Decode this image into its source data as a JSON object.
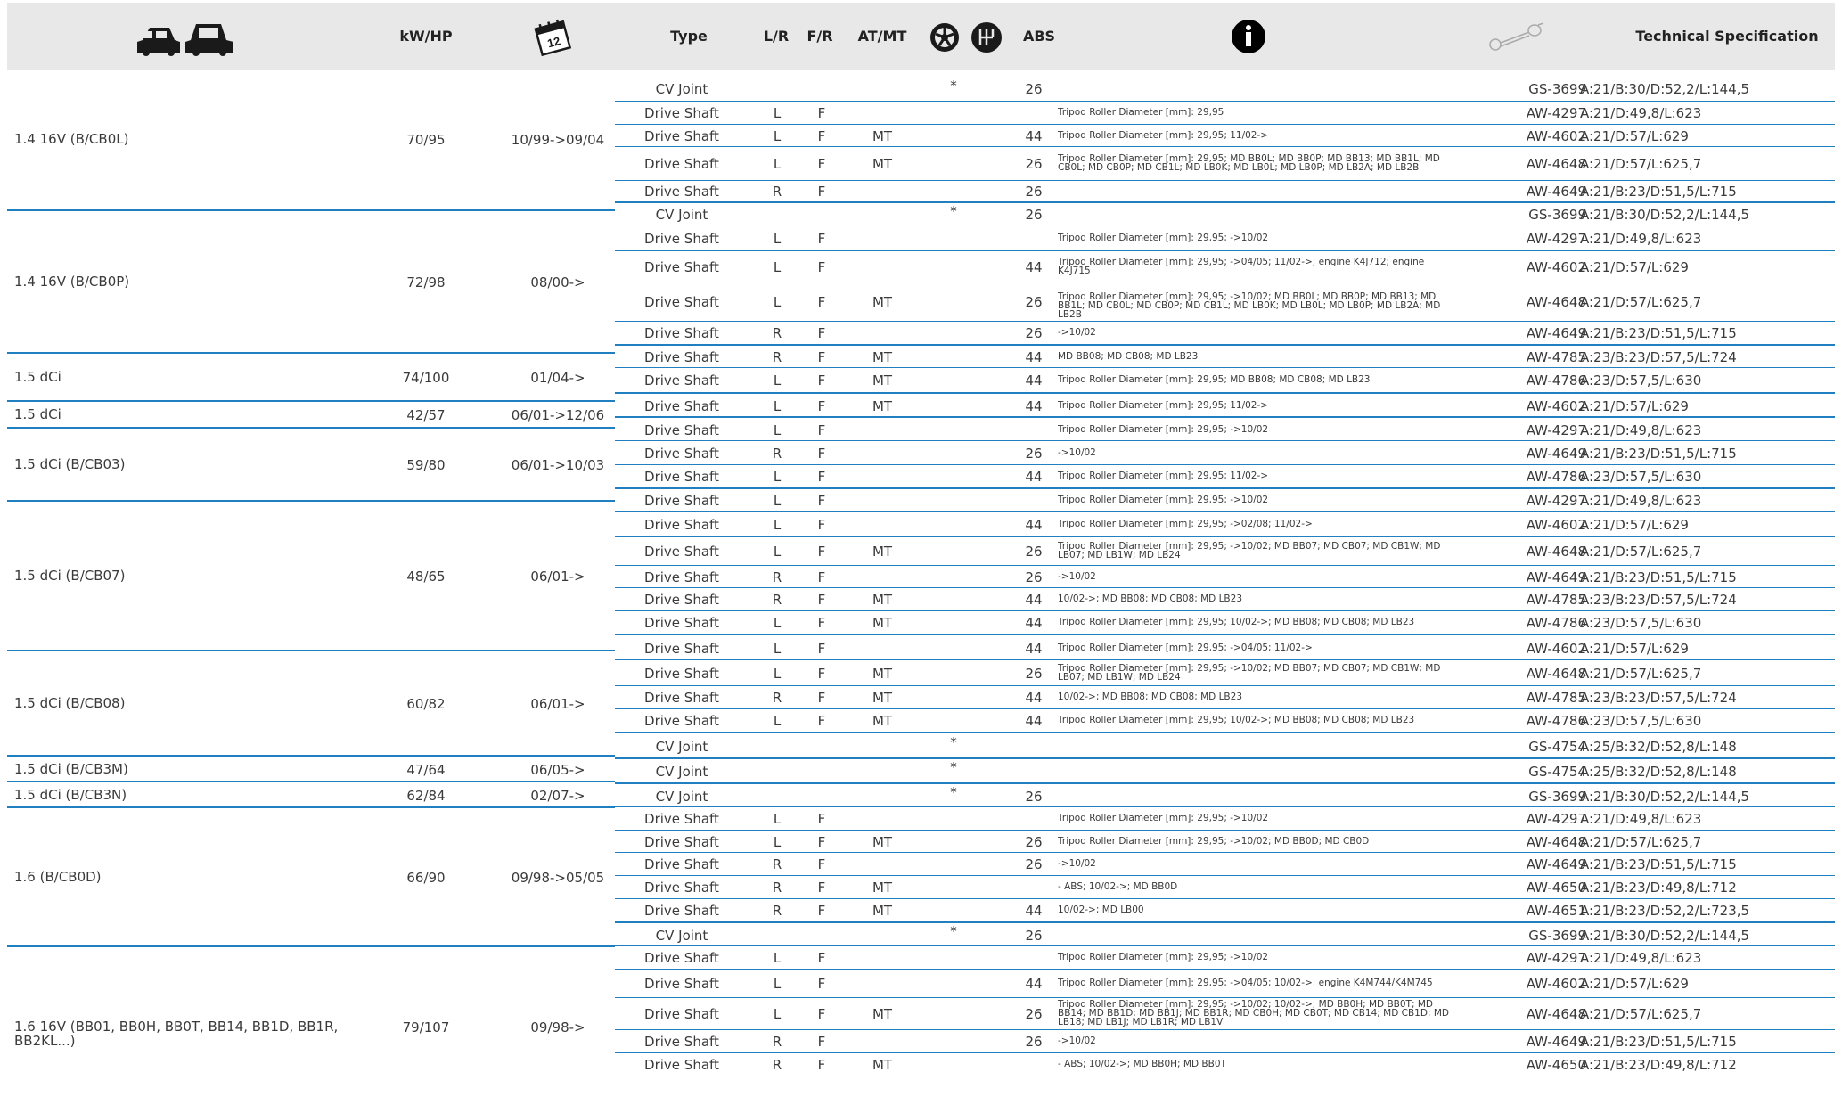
{
  "header": {
    "kw": "kW/HP",
    "type": "Type",
    "lr": "L/R",
    "fr": "F/R",
    "atmt": "AT/MT",
    "abs": "ABS",
    "calendar_num": "12",
    "spec": "Technical Specification",
    "icons": [
      "two-cars-icon",
      "calendar-icon",
      "wheel-icon",
      "gearbox-icon",
      "info-icon",
      "axle-shaft-icon"
    ]
  },
  "groups": [
    {
      "name": "1.4 16V (B/CB0L)",
      "kw": "70/95",
      "years": "10/99->09/04"
    },
    {
      "name": "1.4 16V (B/CB0P)",
      "kw": "72/98",
      "years": "08/00->"
    },
    {
      "name": "1.5 dCi",
      "kw": "74/100",
      "years": "01/04->"
    },
    {
      "name": "1.5 dCi",
      "kw": "42/57",
      "years": "06/01->12/06"
    },
    {
      "name": "1.5 dCi (B/CB03)",
      "kw": "59/80",
      "years": "06/01->10/03"
    },
    {
      "name": "1.5 dCi (B/CB07)",
      "kw": "48/65",
      "years": "06/01->"
    },
    {
      "name": "1.5 dCi (B/CB08)",
      "kw": "60/82",
      "years": "06/01->"
    },
    {
      "name": "1.5 dCi (B/CB3M)",
      "kw": "47/64",
      "years": "06/05->"
    },
    {
      "name": "1.5 dCi (B/CB3N)",
      "kw": "62/84",
      "years": "02/07->"
    },
    {
      "name": "1.6 (B/CB0D)",
      "kw": "66/90",
      "years": "09/98->05/05"
    },
    {
      "name": "1.6 16V (BB01, BB0H, BB0T, BB14, BB1D, BB1R, BB2KL...)",
      "kw": "79/107",
      "years": "09/98->"
    }
  ],
  "rows": [
    {
      "type": "CV Joint",
      "lr": "",
      "fr": "",
      "atmt": "",
      "star": "*",
      "abs": "26",
      "info": "",
      "code": "GS-3699",
      "spec": "A:21/B:30/D:52,2/L:144,5"
    },
    {
      "type": "Drive Shaft",
      "lr": "L",
      "fr": "F",
      "atmt": "",
      "star": "",
      "abs": "",
      "info": "Tripod Roller Diameter [mm]: 29,95",
      "code": "AW-4297",
      "spec": "A:21/D:49,8/L:623"
    },
    {
      "type": "Drive Shaft",
      "lr": "L",
      "fr": "F",
      "atmt": "MT",
      "star": "",
      "abs": "44",
      "info": "Tripod Roller Diameter [mm]: 29,95; 11/02->",
      "code": "AW-4602",
      "spec": "A:21/D:57/L:629"
    },
    {
      "type": "Drive Shaft",
      "lr": "L",
      "fr": "F",
      "atmt": "MT",
      "star": "",
      "abs": "26",
      "info": "Tripod Roller Diameter [mm]: 29,95; MD BB0L; MD BB0P; MD BB13; MD BB1L; MD CB0L; MD CB0P; MD CB1L; MD LB0K; MD LB0L; MD LB0P; MD LB2A; MD LB2B",
      "code": "AW-4648",
      "spec": "A:21/D:57/L:625,7"
    },
    {
      "type": "Drive Shaft",
      "lr": "R",
      "fr": "F",
      "atmt": "",
      "star": "",
      "abs": "26",
      "info": "",
      "code": "AW-4649",
      "spec": "A:21/B:23/D:51,5/L:715"
    },
    {
      "type": "CV Joint",
      "lr": "",
      "fr": "",
      "atmt": "",
      "star": "*",
      "abs": "26",
      "info": "",
      "code": "GS-3699",
      "spec": "A:21/B:30/D:52,2/L:144,5"
    },
    {
      "type": "Drive Shaft",
      "lr": "L",
      "fr": "F",
      "atmt": "",
      "star": "",
      "abs": "",
      "info": "Tripod Roller Diameter [mm]: 29,95; ->10/02",
      "code": "AW-4297",
      "spec": "A:21/D:49,8/L:623"
    },
    {
      "type": "Drive Shaft",
      "lr": "L",
      "fr": "F",
      "atmt": "",
      "star": "",
      "abs": "44",
      "info": "Tripod Roller Diameter [mm]: 29,95; ->04/05; 11/02->; engine K4J712; engine K4J715",
      "code": "AW-4602",
      "spec": "A:21/D:57/L:629"
    },
    {
      "type": "Drive Shaft",
      "lr": "L",
      "fr": "F",
      "atmt": "MT",
      "star": "",
      "abs": "26",
      "info": "Tripod Roller Diameter [mm]: 29,95; ->10/02; MD BB0L; MD BB0P; MD BB13; MD BB1L; MD CB0L; MD CB0P; MD CB1L; MD LB0K; MD LB0L; MD LB0P; MD LB2A; MD LB2B",
      "code": "AW-4648",
      "spec": "A:21/D:57/L:625,7"
    },
    {
      "type": "Drive Shaft",
      "lr": "R",
      "fr": "F",
      "atmt": "",
      "star": "",
      "abs": "26",
      "info": "->10/02",
      "code": "AW-4649",
      "spec": "A:21/B:23/D:51,5/L:715"
    },
    {
      "type": "Drive Shaft",
      "lr": "R",
      "fr": "F",
      "atmt": "MT",
      "star": "",
      "abs": "44",
      "info": "MD BB08; MD CB08; MD LB23",
      "code": "AW-4785",
      "spec": "A:23/B:23/D:57,5/L:724"
    },
    {
      "type": "Drive Shaft",
      "lr": "L",
      "fr": "F",
      "atmt": "MT",
      "star": "",
      "abs": "44",
      "info": "Tripod Roller Diameter [mm]: 29,95; MD BB08; MD CB08; MD LB23",
      "code": "AW-4786",
      "spec": "A:23/D:57,5/L:630"
    },
    {
      "type": "Drive Shaft",
      "lr": "L",
      "fr": "F",
      "atmt": "MT",
      "star": "",
      "abs": "44",
      "info": "Tripod Roller Diameter [mm]: 29,95; 11/02->",
      "code": "AW-4602",
      "spec": "A:21/D:57/L:629"
    },
    {
      "type": "Drive Shaft",
      "lr": "L",
      "fr": "F",
      "atmt": "",
      "star": "",
      "abs": "",
      "info": "Tripod Roller Diameter [mm]: 29,95; ->10/02",
      "code": "AW-4297",
      "spec": "A:21/D:49,8/L:623"
    },
    {
      "type": "Drive Shaft",
      "lr": "R",
      "fr": "F",
      "atmt": "",
      "star": "",
      "abs": "26",
      "info": "->10/02",
      "code": "AW-4649",
      "spec": "A:21/B:23/D:51,5/L:715"
    },
    {
      "type": "Drive Shaft",
      "lr": "L",
      "fr": "F",
      "atmt": "",
      "star": "",
      "abs": "44",
      "info": "Tripod Roller Diameter [mm]: 29,95; 11/02->",
      "code": "AW-4786",
      "spec": "A:23/D:57,5/L:630"
    },
    {
      "type": "Drive Shaft",
      "lr": "L",
      "fr": "F",
      "atmt": "",
      "star": "",
      "abs": "",
      "info": "Tripod Roller Diameter [mm]: 29,95; ->10/02",
      "code": "AW-4297",
      "spec": "A:21/D:49,8/L:623"
    },
    {
      "type": "Drive Shaft",
      "lr": "L",
      "fr": "F",
      "atmt": "",
      "star": "",
      "abs": "44",
      "info": "Tripod Roller Diameter [mm]: 29,95; ->02/08; 11/02->",
      "code": "AW-4602",
      "spec": "A:21/D:57/L:629"
    },
    {
      "type": "Drive Shaft",
      "lr": "L",
      "fr": "F",
      "atmt": "MT",
      "star": "",
      "abs": "26",
      "info": "Tripod Roller Diameter [mm]: 29,95; ->10/02; MD BB07; MD CB07; MD CB1W; MD LB07; MD LB1W; MD LB24",
      "code": "AW-4648",
      "spec": "A:21/D:57/L:625,7"
    },
    {
      "type": "Drive Shaft",
      "lr": "R",
      "fr": "F",
      "atmt": "",
      "star": "",
      "abs": "26",
      "info": "->10/02",
      "code": "AW-4649",
      "spec": "A:21/B:23/D:51,5/L:715"
    },
    {
      "type": "Drive Shaft",
      "lr": "R",
      "fr": "F",
      "atmt": "MT",
      "star": "",
      "abs": "44",
      "info": "10/02->; MD BB08; MD CB08; MD LB23",
      "code": "AW-4785",
      "spec": "A:23/B:23/D:57,5/L:724"
    },
    {
      "type": "Drive Shaft",
      "lr": "L",
      "fr": "F",
      "atmt": "MT",
      "star": "",
      "abs": "44",
      "info": "Tripod Roller Diameter [mm]: 29,95; 10/02->; MD BB08; MD CB08; MD LB23",
      "code": "AW-4786",
      "spec": "A:23/D:57,5/L:630"
    },
    {
      "type": "Drive Shaft",
      "lr": "L",
      "fr": "F",
      "atmt": "",
      "star": "",
      "abs": "44",
      "info": "Tripod Roller Diameter [mm]: 29,95; ->04/05; 11/02->",
      "code": "AW-4602",
      "spec": "A:21/D:57/L:629"
    },
    {
      "type": "Drive Shaft",
      "lr": "L",
      "fr": "F",
      "atmt": "MT",
      "star": "",
      "abs": "26",
      "info": "Tripod Roller Diameter [mm]: 29,95; ->10/02; MD BB07; MD CB07; MD CB1W; MD LB07; MD LB1W; MD LB24",
      "code": "AW-4648",
      "spec": "A:21/D:57/L:625,7"
    },
    {
      "type": "Drive Shaft",
      "lr": "R",
      "fr": "F",
      "atmt": "MT",
      "star": "",
      "abs": "44",
      "info": "10/02->; MD BB08; MD CB08; MD LB23",
      "code": "AW-4785",
      "spec": "A:23/B:23/D:57,5/L:724"
    },
    {
      "type": "Drive Shaft",
      "lr": "L",
      "fr": "F",
      "atmt": "MT",
      "star": "",
      "abs": "44",
      "info": "Tripod Roller Diameter [mm]: 29,95; 10/02->; MD BB08; MD CB08; MD LB23",
      "code": "AW-4786",
      "spec": "A:23/D:57,5/L:630"
    },
    {
      "type": "CV Joint",
      "lr": "",
      "fr": "",
      "atmt": "",
      "star": "*",
      "abs": "",
      "info": "",
      "code": "GS-4754",
      "spec": "A:25/B:32/D:52,8/L:148"
    },
    {
      "type": "CV Joint",
      "lr": "",
      "fr": "",
      "atmt": "",
      "star": "*",
      "abs": "",
      "info": "",
      "code": "GS-4754",
      "spec": "A:25/B:32/D:52,8/L:148"
    },
    {
      "type": "CV Joint",
      "lr": "",
      "fr": "",
      "atmt": "",
      "star": "*",
      "abs": "26",
      "info": "",
      "code": "GS-3699",
      "spec": "A:21/B:30/D:52,2/L:144,5"
    },
    {
      "type": "Drive Shaft",
      "lr": "L",
      "fr": "F",
      "atmt": "",
      "star": "",
      "abs": "",
      "info": "Tripod Roller Diameter [mm]: 29,95; ->10/02",
      "code": "AW-4297",
      "spec": "A:21/D:49,8/L:623"
    },
    {
      "type": "Drive Shaft",
      "lr": "L",
      "fr": "F",
      "atmt": "MT",
      "star": "",
      "abs": "26",
      "info": "Tripod Roller Diameter [mm]: 29,95; ->10/02; MD BB0D; MD CB0D",
      "code": "AW-4648",
      "spec": "A:21/D:57/L:625,7"
    },
    {
      "type": "Drive Shaft",
      "lr": "R",
      "fr": "F",
      "atmt": "",
      "star": "",
      "abs": "26",
      "info": "->10/02",
      "code": "AW-4649",
      "spec": "A:21/B:23/D:51,5/L:715"
    },
    {
      "type": "Drive Shaft",
      "lr": "R",
      "fr": "F",
      "atmt": "MT",
      "star": "",
      "abs": "",
      "info": "- ABS; 10/02->; MD BB0D",
      "code": "AW-4650",
      "spec": "A:21/B:23/D:49,8/L:712"
    },
    {
      "type": "Drive Shaft",
      "lr": "R",
      "fr": "F",
      "atmt": "MT",
      "star": "",
      "abs": "44",
      "info": "10/02->; MD LB00",
      "code": "AW-4651",
      "spec": "A:21/B:23/D:52,2/L:723,5"
    },
    {
      "type": "CV Joint",
      "lr": "",
      "fr": "",
      "atmt": "",
      "star": "*",
      "abs": "26",
      "info": "",
      "code": "GS-3699",
      "spec": "A:21/B:30/D:52,2/L:144,5"
    },
    {
      "type": "Drive Shaft",
      "lr": "L",
      "fr": "F",
      "atmt": "",
      "star": "",
      "abs": "",
      "info": "Tripod Roller Diameter [mm]: 29,95; ->10/02",
      "code": "AW-4297",
      "spec": "A:21/D:49,8/L:623"
    },
    {
      "type": "Drive Shaft",
      "lr": "L",
      "fr": "F",
      "atmt": "",
      "star": "",
      "abs": "44",
      "info": "Tripod Roller Diameter [mm]: 29,95; ->04/05; 10/02->; engine K4M744/K4M745",
      "code": "AW-4602",
      "spec": "A:21/D:57/L:629"
    },
    {
      "type": "Drive Shaft",
      "lr": "L",
      "fr": "F",
      "atmt": "MT",
      "star": "",
      "abs": "26",
      "info": "Tripod Roller Diameter [mm]: 29,95; ->10/02; 10/02->; MD BB0H; MD BB0T; MD BB14; MD BB1D; MD BB1J; MD BB1R; MD CB0H; MD CB0T; MD CB14; MD CB1D; MD LB18; MD LB1J; MD LB1R; MD LB1V",
      "code": "AW-4648",
      "spec": "A:21/D:57/L:625,7"
    },
    {
      "type": "Drive Shaft",
      "lr": "R",
      "fr": "F",
      "atmt": "",
      "star": "",
      "abs": "26",
      "info": "->10/02",
      "code": "AW-4649",
      "spec": "A:21/B:23/D:51,5/L:715"
    },
    {
      "type": "Drive Shaft",
      "lr": "R",
      "fr": "F",
      "atmt": "MT",
      "star": "",
      "abs": "",
      "info": "- ABS; 10/02->; MD BB0H; MD BB0T",
      "code": "AW-4650",
      "spec": "A:21/B:23/D:49,8/L:712"
    }
  ]
}
